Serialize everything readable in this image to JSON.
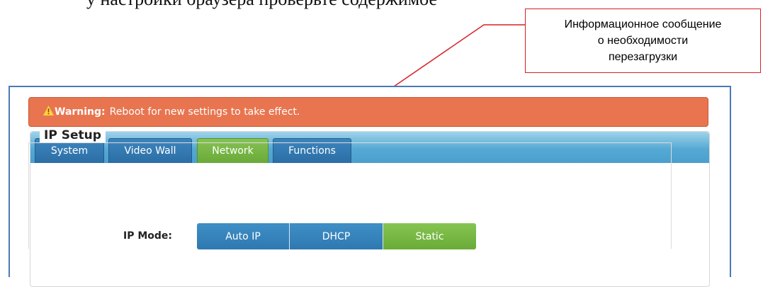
{
  "doc_text": "у настройки браузера проверьте содержимое",
  "callout": {
    "lines": [
      "Информационное сообщение",
      "о необходимости",
      "перезагрузки"
    ]
  },
  "warning": {
    "icon": "warning-icon",
    "label": "Warning:",
    "message": "Reboot for new settings to take effect.",
    "color": "#e8754f"
  },
  "tabs": [
    {
      "label": "System",
      "active": false
    },
    {
      "label": "Video Wall",
      "active": false
    },
    {
      "label": "Network",
      "active": true
    },
    {
      "label": "Functions",
      "active": false
    }
  ],
  "ip_setup": {
    "title": "IP Setup",
    "mode_label": "IP Mode:",
    "modes": [
      {
        "label": "Auto IP",
        "selected": false
      },
      {
        "label": "DHCP",
        "selected": false
      },
      {
        "label": "Static",
        "selected": true
      }
    ]
  },
  "colors": {
    "accent_blue": "#2f78b1",
    "active_green": "#6aab37",
    "callout_border": "#d62027"
  }
}
